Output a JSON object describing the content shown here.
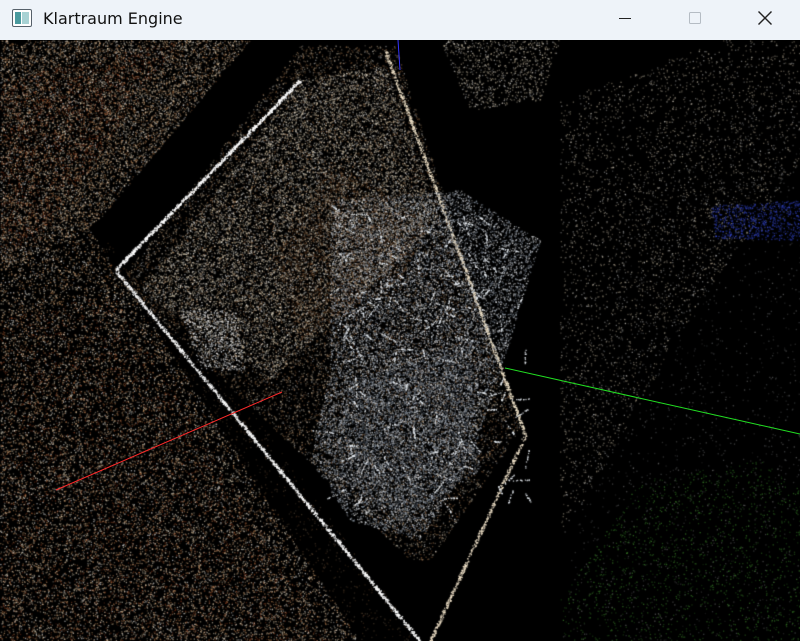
{
  "window": {
    "title": "Klartraum Engine",
    "app_icon": "app-window-icon",
    "controls": {
      "minimize_icon": "minimize-icon",
      "maximize_icon": "maximize-icon",
      "close_icon": "close-icon"
    }
  },
  "viewport": {
    "content": "point-cloud-render",
    "background": "#000000",
    "axes": {
      "x_color": "#ff2020",
      "y_color": "#20e020",
      "z_color": "#3030ff"
    },
    "palette": {
      "light": "#f4e6cc",
      "warm": "#c9905e",
      "rust": "#8a3a1c",
      "grey": "#9aa6b4",
      "green": "#2e6a22",
      "blue": "#2a3aa8"
    }
  }
}
